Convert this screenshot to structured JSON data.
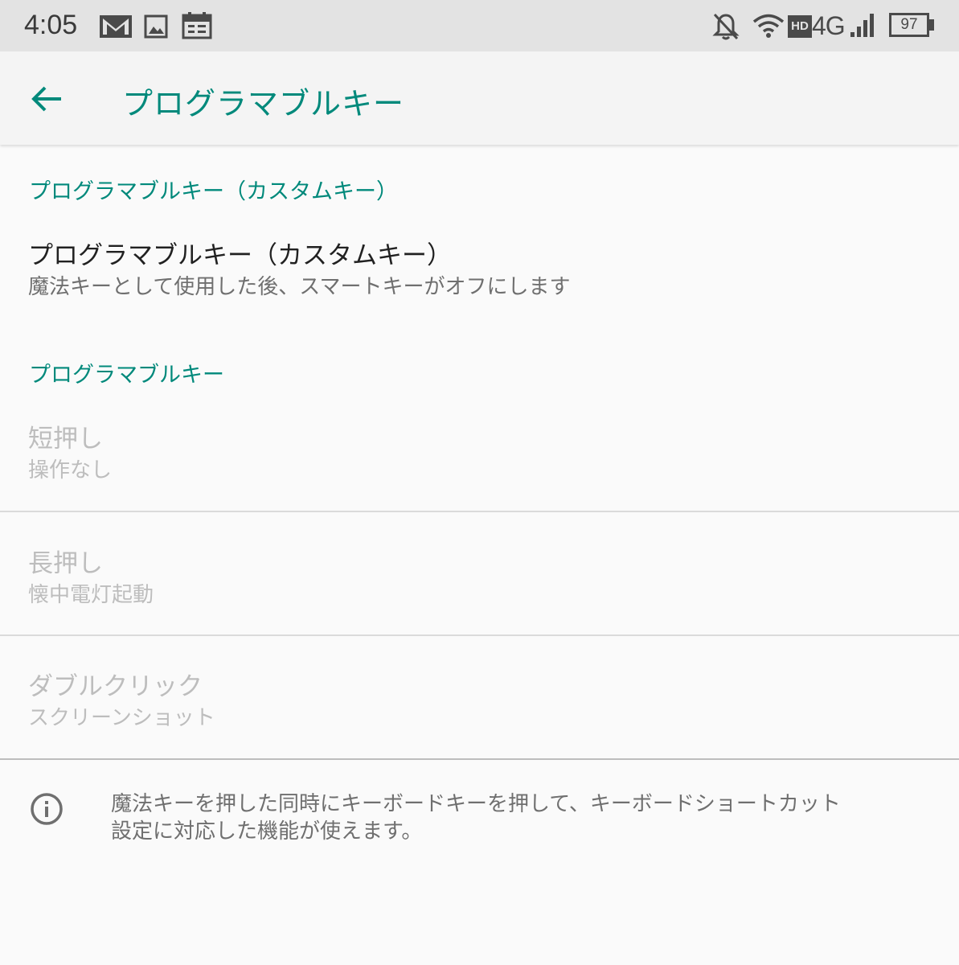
{
  "status_bar": {
    "time": "4:05",
    "battery": "97",
    "network_label": "4G",
    "hd_label": "HD",
    "icons": [
      "gmail-icon",
      "image-icon",
      "calendar-icon",
      "notifications-off-icon",
      "wifi-icon",
      "hd-voice-icon",
      "signal-icon",
      "battery-icon"
    ]
  },
  "app_bar": {
    "title": "プログラマブルキー",
    "back_icon": "arrow-back-icon"
  },
  "sections": {
    "custom": {
      "header": "プログラマブルキー（カスタムキー）",
      "item": {
        "title": "プログラマブルキー（カスタムキー）",
        "summary": "魔法キーとして使用した後、スマートキーがオフにします"
      }
    },
    "programmable": {
      "header": "プログラマブルキー",
      "items": [
        {
          "title": "短押し",
          "summary": "操作なし"
        },
        {
          "title": "長押し",
          "summary": "懐中電灯起動"
        },
        {
          "title": "ダブルクリック",
          "summary": "スクリーンショット"
        }
      ]
    }
  },
  "footer_info": {
    "icon": "info-icon",
    "lines": [
      "魔法キーを押した同時にキーボードキーを押して、キーボードショートカット",
      "設定に対応した機能が使えます。"
    ]
  },
  "colors": {
    "accent": "#00897b",
    "disabled_text": "#bdbdbd",
    "status_bar_bg": "#e3e3e3"
  }
}
